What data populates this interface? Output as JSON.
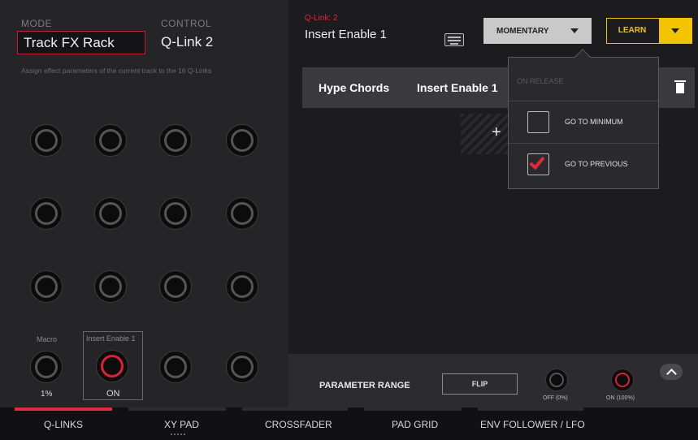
{
  "header": {
    "mode_label": "MODE",
    "mode_value": "Track FX Rack",
    "control_label": "CONTROL",
    "control_value": "Q-Link 2",
    "hint": "Assign effect parameters of the current track to the 16 Q-Links"
  },
  "knobs": {
    "macro_label": "Macro",
    "macro_value": "1%",
    "insert_label": "Insert Enable 1",
    "insert_value": "ON"
  },
  "qlink": {
    "subtitle": "Q-Link: 2",
    "title": "Insert Enable 1",
    "mode_select": "MOMENTARY",
    "learn_label": "LEARN"
  },
  "assignment_row": {
    "name": "Hype Chords",
    "param": "Insert Enable 1"
  },
  "dropdown": {
    "heading": "ON RELEASE",
    "options": [
      {
        "label": "GO TO MINIMUM",
        "checked": false
      },
      {
        "label": "GO TO PREVIOUS",
        "checked": true
      }
    ]
  },
  "range": {
    "label": "PARAMETER RANGE",
    "flip_label": "FLIP",
    "min_label": "OFF (0%)",
    "max_label": "ON (100%)"
  },
  "tabs": [
    {
      "label": "Q-LINKS",
      "active": true
    },
    {
      "label": "XY PAD",
      "active": false
    },
    {
      "label": "CROSSFADER",
      "active": false
    },
    {
      "label": "PAD GRID",
      "active": false
    },
    {
      "label": "ENV FOLLOWER / LFO",
      "active": false
    }
  ],
  "colors": {
    "accent_red": "#e0283e",
    "learn_yellow": "#f2c400"
  }
}
